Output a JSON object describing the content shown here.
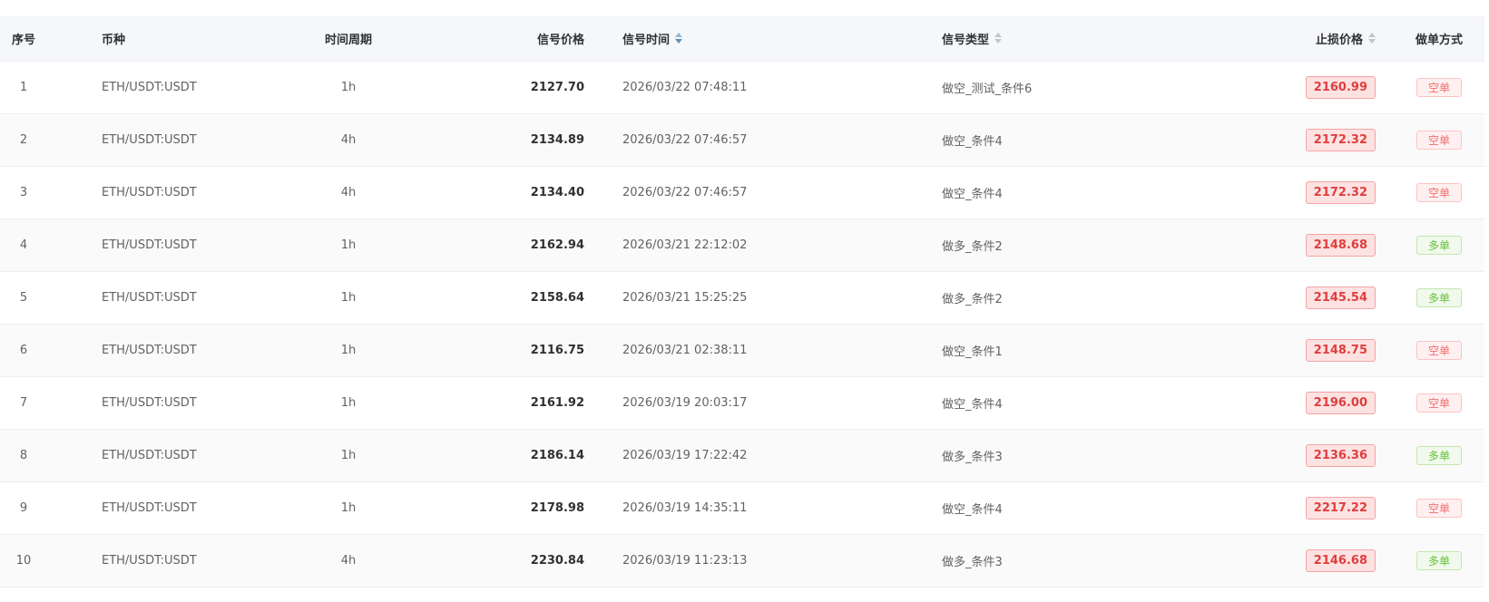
{
  "columns": {
    "index": "序号",
    "symbol": "币种",
    "period": "时间周期",
    "signal_price": "信号价格",
    "signal_time": "信号时间",
    "signal_type": "信号类型",
    "stop_price": "止损价格",
    "side": "做单方式"
  },
  "colors": {
    "short_tag": "#f56c6c",
    "long_tag": "#67c23a",
    "stop_tag_bg": "#fde2e2",
    "stop_tag_text": "#e03e3e"
  },
  "rows": [
    {
      "index": "1",
      "symbol": "ETH/USDT:USDT",
      "period": "1h",
      "signal_price": "2127.70",
      "signal_time": "2026/03/22 07:48:11",
      "signal_type": "做空_测试_条件6",
      "stop_price": "2160.99",
      "side": "空单",
      "side_kind": "short"
    },
    {
      "index": "2",
      "symbol": "ETH/USDT:USDT",
      "period": "4h",
      "signal_price": "2134.89",
      "signal_time": "2026/03/22 07:46:57",
      "signal_type": "做空_条件4",
      "stop_price": "2172.32",
      "side": "空单",
      "side_kind": "short"
    },
    {
      "index": "3",
      "symbol": "ETH/USDT:USDT",
      "period": "4h",
      "signal_price": "2134.40",
      "signal_time": "2026/03/22 07:46:57",
      "signal_type": "做空_条件4",
      "stop_price": "2172.32",
      "side": "空单",
      "side_kind": "short"
    },
    {
      "index": "4",
      "symbol": "ETH/USDT:USDT",
      "period": "1h",
      "signal_price": "2162.94",
      "signal_time": "2026/03/21 22:12:02",
      "signal_type": "做多_条件2",
      "stop_price": "2148.68",
      "side": "多单",
      "side_kind": "long"
    },
    {
      "index": "5",
      "symbol": "ETH/USDT:USDT",
      "period": "1h",
      "signal_price": "2158.64",
      "signal_time": "2026/03/21 15:25:25",
      "signal_type": "做多_条件2",
      "stop_price": "2145.54",
      "side": "多单",
      "side_kind": "long"
    },
    {
      "index": "6",
      "symbol": "ETH/USDT:USDT",
      "period": "1h",
      "signal_price": "2116.75",
      "signal_time": "2026/03/21 02:38:11",
      "signal_type": "做空_条件1",
      "stop_price": "2148.75",
      "side": "空单",
      "side_kind": "short"
    },
    {
      "index": "7",
      "symbol": "ETH/USDT:USDT",
      "period": "1h",
      "signal_price": "2161.92",
      "signal_time": "2026/03/19 20:03:17",
      "signal_type": "做空_条件4",
      "stop_price": "2196.00",
      "side": "空单",
      "side_kind": "short"
    },
    {
      "index": "8",
      "symbol": "ETH/USDT:USDT",
      "period": "1h",
      "signal_price": "2186.14",
      "signal_time": "2026/03/19 17:22:42",
      "signal_type": "做多_条件3",
      "stop_price": "2136.36",
      "side": "多单",
      "side_kind": "long"
    },
    {
      "index": "9",
      "symbol": "ETH/USDT:USDT",
      "period": "1h",
      "signal_price": "2178.98",
      "signal_time": "2026/03/19 14:35:11",
      "signal_type": "做空_条件4",
      "stop_price": "2217.22",
      "side": "空单",
      "side_kind": "short"
    },
    {
      "index": "10",
      "symbol": "ETH/USDT:USDT",
      "period": "4h",
      "signal_price": "2230.84",
      "signal_time": "2026/03/19 11:23:13",
      "signal_type": "做多_条件3",
      "stop_price": "2146.68",
      "side": "多单",
      "side_kind": "long"
    }
  ]
}
